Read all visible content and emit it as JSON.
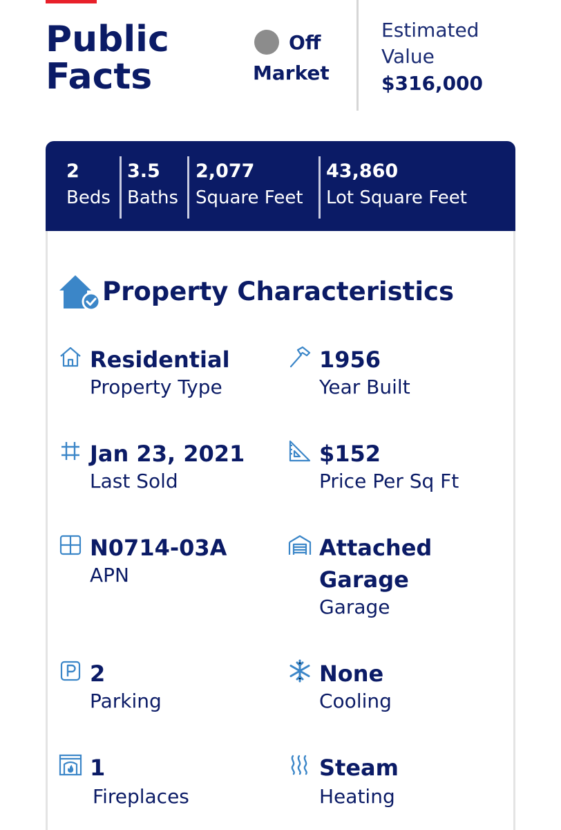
{
  "header": {
    "title_line1": "Public",
    "title_line2": "Facts",
    "status_word1": "Off",
    "status_word2": "Market",
    "estimate_label_line1": "Estimated",
    "estimate_label_line2": "Value",
    "estimate_value": "$316,000"
  },
  "colors": {
    "brand_navy": "#0b1b66",
    "accent_red": "#e8202a",
    "icon_blue": "#3b86c8",
    "status_gray": "#8c8c8c"
  },
  "stats": [
    {
      "value": "2",
      "unit": "Beds"
    },
    {
      "value": "3.5",
      "unit": "Baths"
    },
    {
      "value": "2,077",
      "unit": "Square Feet"
    },
    {
      "value": "43,860",
      "unit": "Lot Square Feet"
    }
  ],
  "characteristics": {
    "title": "Property Characteristics",
    "title_icon": "house-check-icon",
    "facts": [
      {
        "icon": "house-outline-icon",
        "value": "Residential",
        "label": "Property Type"
      },
      {
        "icon": "hammer-icon",
        "value": "1956",
        "label": "Year Built"
      },
      {
        "icon": "hashtag-icon",
        "value": "Jan 23, 2021",
        "label": "Last Sold"
      },
      {
        "icon": "ruler-triangle-icon",
        "value": "$152",
        "label": "Price Per Sq Ft"
      },
      {
        "icon": "parcel-grid-icon",
        "value": "N0714-03A",
        "label": "APN"
      },
      {
        "icon": "garage-icon",
        "value_line1": "Attached",
        "value_line2": "Garage",
        "label": "Garage"
      },
      {
        "icon": "parking-icon",
        "value": "2",
        "label": "Parking"
      },
      {
        "icon": "snowflake-icon",
        "value": "None",
        "label": "Cooling"
      },
      {
        "icon": "fireplace-icon",
        "value": "1",
        "label": "Fireplaces"
      },
      {
        "icon": "heat-waves-icon",
        "value": "Steam",
        "label": "Heating"
      }
    ]
  }
}
